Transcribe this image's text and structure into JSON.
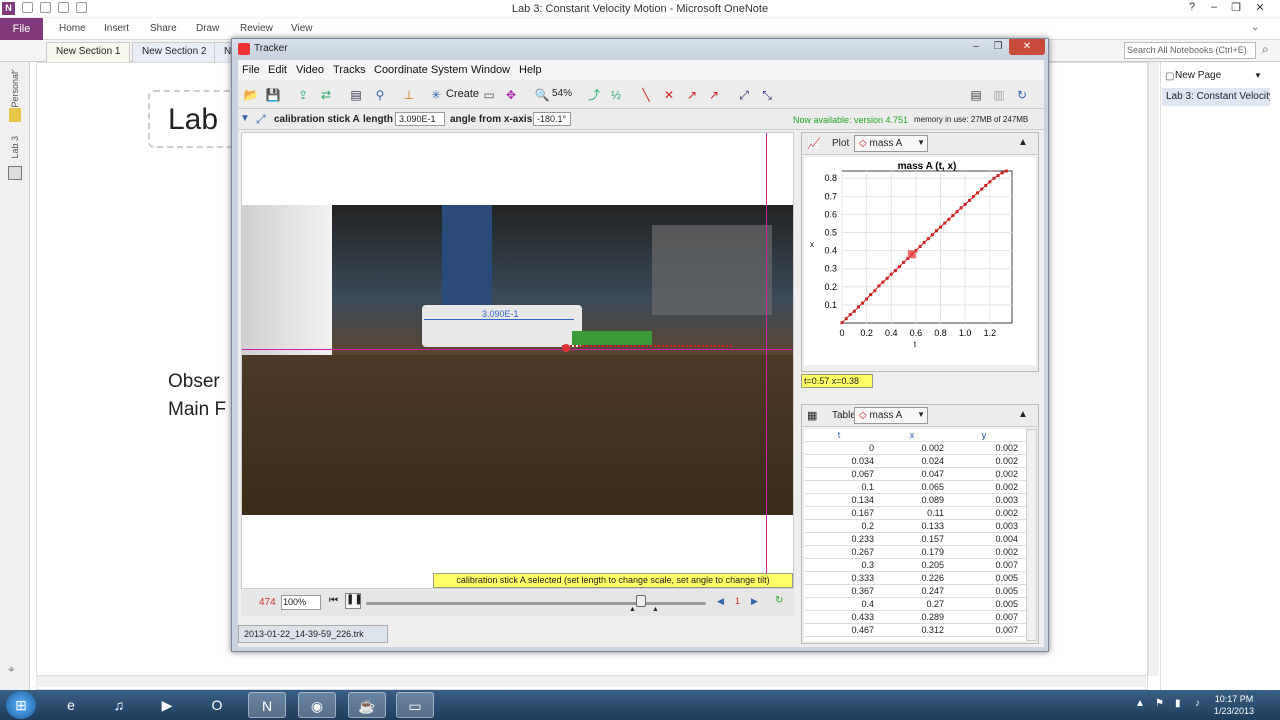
{
  "onenote": {
    "title": "Lab 3: Constant Velocity Motion - Microsoft OneNote",
    "ribbon_tabs": [
      "File",
      "Home",
      "Insert",
      "Share",
      "Draw",
      "Review",
      "View"
    ],
    "sections": [
      "New Section 1",
      "New Section 2",
      "N"
    ],
    "search_placeholder": "Search All Notebooks (Ctrl+E)",
    "sidebar_labels": [
      "Personal",
      "Lab 3"
    ],
    "page_title": "Lab",
    "page_text_1": "Obser",
    "page_text_2": "Main F",
    "new_page": "New Page",
    "pages": [
      "Lab 3: Constant Velocity"
    ]
  },
  "tracker": {
    "title": "Tracker",
    "menu": [
      "File",
      "Edit",
      "Video",
      "Tracks",
      "Coordinate System",
      "Window",
      "Help"
    ],
    "toolbar": {
      "create_label": "Create",
      "zoom_label": "54%"
    },
    "calibration": {
      "name": "calibration stick A",
      "length_label": "length",
      "length_value": "3.090E-1",
      "angle_label": "angle from x-axis",
      "angle_value": "-180.1°",
      "available": "Now available: version 4.751",
      "memory": "memory in use: 27MB of 247MB"
    },
    "video": {
      "stick_label": "3.090E-1"
    },
    "status_tip": "calibration stick A selected (set length to change scale, set angle to change tilt)",
    "player": {
      "frame": "474",
      "zoom": "100%",
      "step": "1"
    },
    "file_tab": "2013-01-22_14-39-59_226.trk",
    "plot": {
      "header_label": "Plot",
      "track": "mass A",
      "readout": "t=0.57  x=0.38"
    },
    "table": {
      "header_label": "Table",
      "track": "mass A",
      "columns": [
        "t",
        "x",
        "y"
      ],
      "rows": [
        [
          "0",
          "0.002",
          "0.002"
        ],
        [
          "0.034",
          "0.024",
          "0.002"
        ],
        [
          "0.067",
          "0.047",
          "0.002"
        ],
        [
          "0.1",
          "0.065",
          "0.002"
        ],
        [
          "0.134",
          "0.089",
          "0.003"
        ],
        [
          "0.167",
          "0.11",
          "0.002"
        ],
        [
          "0.2",
          "0.133",
          "0.003"
        ],
        [
          "0.233",
          "0.157",
          "0.004"
        ],
        [
          "0.267",
          "0.179",
          "0.002"
        ],
        [
          "0.3",
          "0.205",
          "0.007"
        ],
        [
          "0.333",
          "0.226",
          "0.005"
        ],
        [
          "0.367",
          "0.247",
          "0.005"
        ],
        [
          "0.4",
          "0.27",
          "0.005"
        ],
        [
          "0.433",
          "0.289",
          "0.007"
        ],
        [
          "0.467",
          "0.312",
          "0.007"
        ]
      ]
    }
  },
  "taskbar": {
    "time": "10:17 PM",
    "date": "1/23/2013"
  },
  "colors": {
    "onenote_purple": "#80397b",
    "track_red": "#cc2222",
    "axis_magenta": "#cc22aa",
    "tip_yellow": "#ffff66"
  },
  "chart_data": {
    "type": "scatter",
    "title": "mass A (t, x)",
    "xlabel": "t",
    "ylabel": "x",
    "xlim": [
      0,
      1.38
    ],
    "ylim": [
      0,
      0.84
    ],
    "xticks": [
      "0",
      "0.2",
      "0.4",
      "0.6",
      "0.8",
      "1.0",
      "1.2"
    ],
    "yticks": [
      "0.1",
      "0.2",
      "0.3",
      "0.4",
      "0.5",
      "0.6",
      "0.7",
      "0.8"
    ],
    "x": [
      0,
      0.034,
      0.067,
      0.1,
      0.134,
      0.167,
      0.2,
      0.233,
      0.267,
      0.3,
      0.333,
      0.367,
      0.4,
      0.433,
      0.467,
      0.5,
      0.534,
      0.567,
      0.6,
      0.634,
      0.667,
      0.7,
      0.734,
      0.767,
      0.8,
      0.834,
      0.867,
      0.9,
      0.934,
      0.967,
      1.0,
      1.034,
      1.067,
      1.1,
      1.134,
      1.167,
      1.2,
      1.234,
      1.267,
      1.3,
      1.334
    ],
    "y": [
      0.002,
      0.024,
      0.047,
      0.065,
      0.089,
      0.11,
      0.133,
      0.157,
      0.179,
      0.205,
      0.226,
      0.247,
      0.27,
      0.289,
      0.312,
      0.335,
      0.357,
      0.38,
      0.4,
      0.423,
      0.445,
      0.466,
      0.488,
      0.51,
      0.53,
      0.552,
      0.573,
      0.594,
      0.615,
      0.636,
      0.656,
      0.677,
      0.698,
      0.719,
      0.74,
      0.76,
      0.78,
      0.8,
      0.815,
      0.83,
      0.84
    ],
    "highlight": {
      "x": 0.567,
      "y": 0.38
    }
  }
}
